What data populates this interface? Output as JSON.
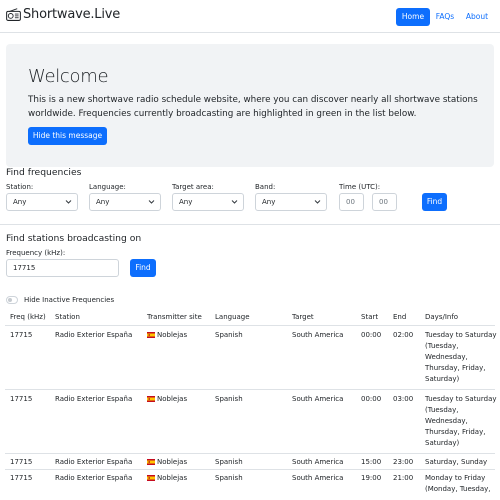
{
  "brand": {
    "name": "Shortwave.Live",
    "icon": "radio-icon"
  },
  "nav": {
    "home": "Home",
    "faqs": "FAQs",
    "about": "About",
    "accent": "#0d6efd"
  },
  "welcome": {
    "title": "Welcome",
    "text": "This is a new shortwave radio schedule website, where you can discover nearly all shortwave stations worldwide. Frequencies currently broadcasting are highlighted in green in the list below.",
    "hide_button": "Hide this message"
  },
  "find_frequencies": {
    "title": "Find frequencies",
    "station": {
      "label": "Station:",
      "value": "Any"
    },
    "language": {
      "label": "Language:",
      "value": "Any"
    },
    "target": {
      "label": "Target area:",
      "value": "Any"
    },
    "band": {
      "label": "Band:",
      "value": "Any"
    },
    "time": {
      "label": "Time (UTC):",
      "from_placeholder": "00",
      "to_placeholder": "00"
    },
    "find_button": "Find"
  },
  "find_stations": {
    "title": "Find stations broadcasting on",
    "freq_label": "Frequency (kHz):",
    "freq_value": "17715",
    "find_button": "Find"
  },
  "toggle": {
    "label": "Hide Inactive Frequencies",
    "checked": false
  },
  "table": {
    "headers": [
      "Freq (kHz)",
      "Station",
      "Transmitter site",
      "Language",
      "Target",
      "Start",
      "End",
      "Days/Info"
    ],
    "rows": [
      {
        "freq": "17715",
        "station": "Radio Exterior España",
        "site": "Noblejas",
        "language": "Spanish",
        "target": "South America",
        "start": "00:00",
        "end": "02:00",
        "days": [
          "Tuesday to Saturday",
          "(Tuesday,",
          "Wednesday,",
          "Thursday, Friday,",
          "Saturday)"
        ]
      },
      {
        "freq": "17715",
        "station": "Radio Exterior España",
        "site": "Noblejas",
        "language": "Spanish",
        "target": "South America",
        "start": "00:00",
        "end": "03:00",
        "days": [
          "Tuesday to Saturday",
          "(Tuesday,",
          "Wednesday,",
          "Thursday, Friday,",
          "Saturday)"
        ]
      },
      {
        "freq": "17715",
        "station": "Radio Exterior España",
        "site": "Noblejas",
        "language": "Spanish",
        "target": "South America",
        "start": "15:00",
        "end": "23:00",
        "days": [
          "Saturday, Sunday"
        ]
      },
      {
        "freq": "17715",
        "station": "Radio Exterior España",
        "site": "Noblejas",
        "language": "Spanish",
        "target": "South America",
        "start": "19:00",
        "end": "21:00",
        "days": [
          "Monday to Friday",
          "(Monday, Tuesday,"
        ]
      }
    ]
  }
}
